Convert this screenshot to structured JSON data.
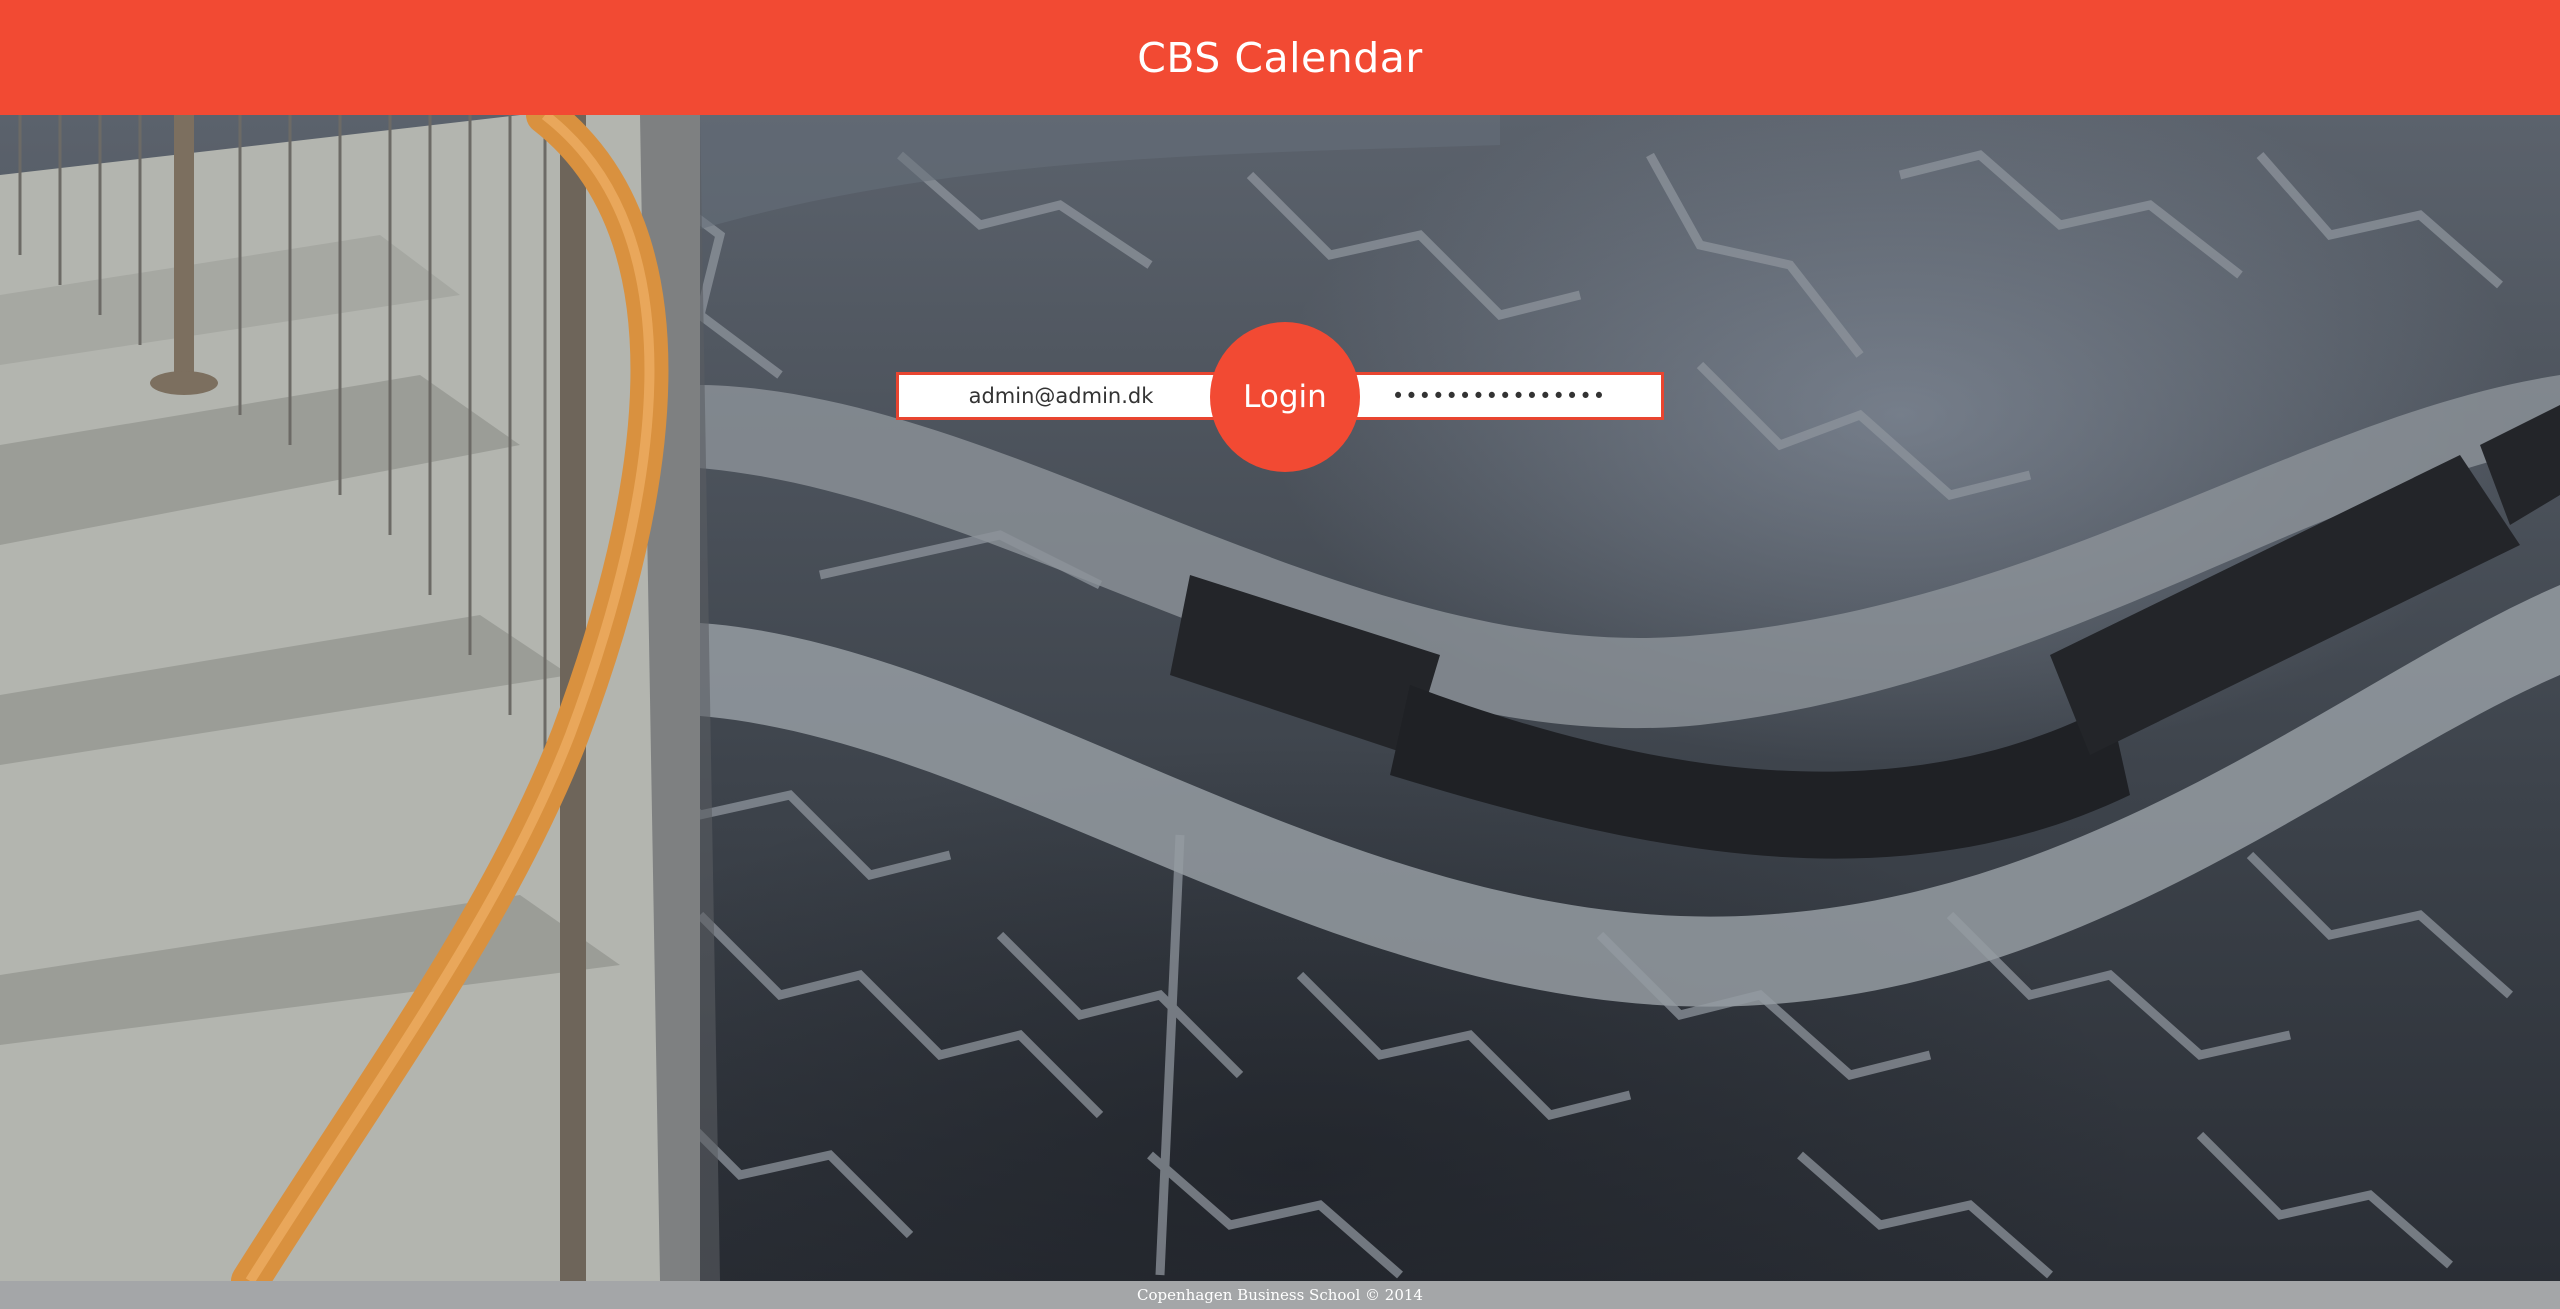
{
  "header": {
    "title": "CBS Calendar"
  },
  "login": {
    "email_value": "admin@admin.dk",
    "password_value": "••••••••••••••••",
    "button_label": "Login"
  },
  "footer": {
    "text": "Copenhagen Business School © 2014"
  },
  "colors": {
    "accent": "#f24a33",
    "field_border": "#e84530",
    "handrail": "#d9913f"
  },
  "background": {
    "image": "staircase-and-stone-floor-photo"
  }
}
